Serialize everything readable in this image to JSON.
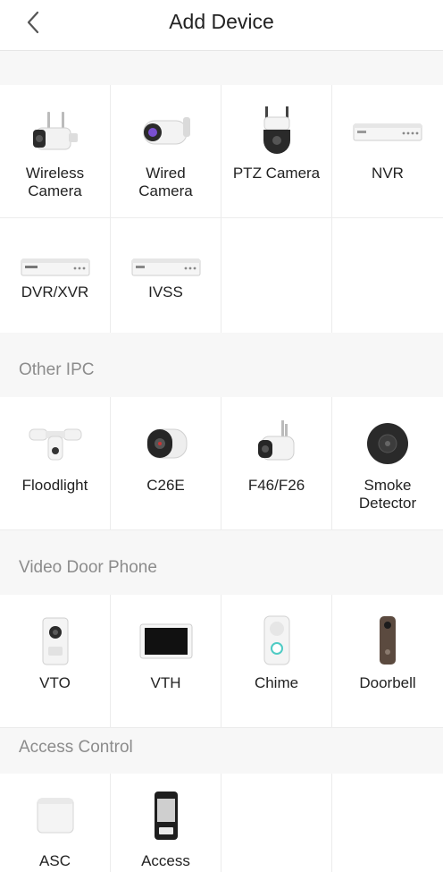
{
  "header": {
    "title": "Add Device"
  },
  "sections": {
    "main": {
      "items": [
        {
          "label": "Wireless\nCamera",
          "icon": "wireless-camera-icon"
        },
        {
          "label": "Wired\nCamera",
          "icon": "wired-camera-icon"
        },
        {
          "label": "PTZ Camera",
          "icon": "ptz-camera-icon"
        },
        {
          "label": "NVR",
          "icon": "nvr-icon"
        },
        {
          "label": "DVR/XVR",
          "icon": "dvr-icon"
        },
        {
          "label": "IVSS",
          "icon": "ivss-icon"
        }
      ]
    },
    "other_ipc": {
      "title": "Other IPC",
      "items": [
        {
          "label": "Floodlight",
          "icon": "floodlight-icon"
        },
        {
          "label": "C26E",
          "icon": "c26e-camera-icon"
        },
        {
          "label": "F46/F26",
          "icon": "f46-camera-icon"
        },
        {
          "label": "Smoke\nDetector",
          "icon": "smoke-detector-icon"
        }
      ]
    },
    "video_door_phone": {
      "title": "Video Door Phone",
      "items": [
        {
          "label": "VTO",
          "icon": "vto-icon"
        },
        {
          "label": "VTH",
          "icon": "vth-icon"
        },
        {
          "label": "Chime",
          "icon": "chime-icon"
        },
        {
          "label": "Doorbell",
          "icon": "doorbell-icon"
        }
      ]
    },
    "access_control": {
      "title": "Access Control",
      "items": [
        {
          "label": "ASC",
          "icon": "asc-icon"
        },
        {
          "label": "Access",
          "icon": "access-terminal-icon"
        }
      ]
    }
  }
}
